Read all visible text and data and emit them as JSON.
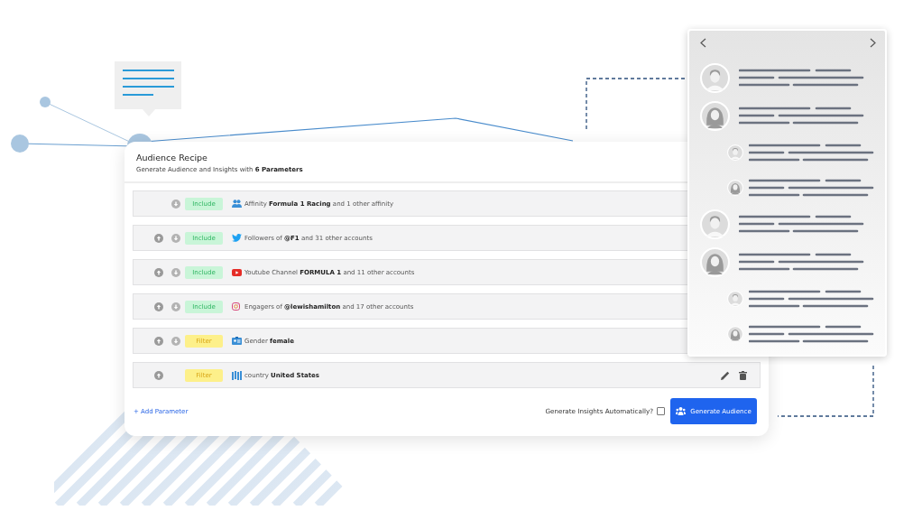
{
  "recipe": {
    "title": "Audience Recipe",
    "subtitle": "Generate Audience and Insights with **6 Parameters**",
    "rows": [
      {
        "up": false,
        "down": true,
        "kind": "include",
        "badge": "Include",
        "text": "Affinity **Formula 1 Racing** and 1 other affinity",
        "actions": false
      },
      {
        "up": true,
        "down": true,
        "kind": "include",
        "badge": "Include",
        "text": "Followers of **@F1** and 31 other accounts",
        "actions": false
      },
      {
        "up": true,
        "down": true,
        "kind": "include",
        "badge": "Include",
        "text": "Youtube Channel **FORMULA 1** and 11 other accounts",
        "actions": false
      },
      {
        "up": true,
        "down": true,
        "kind": "include",
        "badge": "Include",
        "text": "Engagers of **@lewishamilton** and 17 other accounts",
        "actions": false
      },
      {
        "up": true,
        "down": true,
        "kind": "filter",
        "badge": "Filter",
        "text": "Gender **female**",
        "actions": false
      },
      {
        "up": true,
        "down": false,
        "kind": "filter",
        "badge": "Filter",
        "text": "country **United States**",
        "actions": true
      }
    ],
    "add_link": "+ Add Parameter",
    "auto_insights": {
      "label": "Generate Insights Automatically?",
      "checked": false
    },
    "generate_button": "Generate Audience"
  },
  "comments": [
    {
      "kind": "male",
      "nested": false
    },
    {
      "kind": "female",
      "nested": false
    },
    {
      "kind": "male",
      "nested": true
    },
    {
      "kind": "female",
      "nested": true
    },
    {
      "kind": "male",
      "nested": false
    },
    {
      "kind": "female",
      "nested": false
    },
    {
      "kind": "male",
      "nested": true
    },
    {
      "kind": "female",
      "nested": true
    }
  ]
}
